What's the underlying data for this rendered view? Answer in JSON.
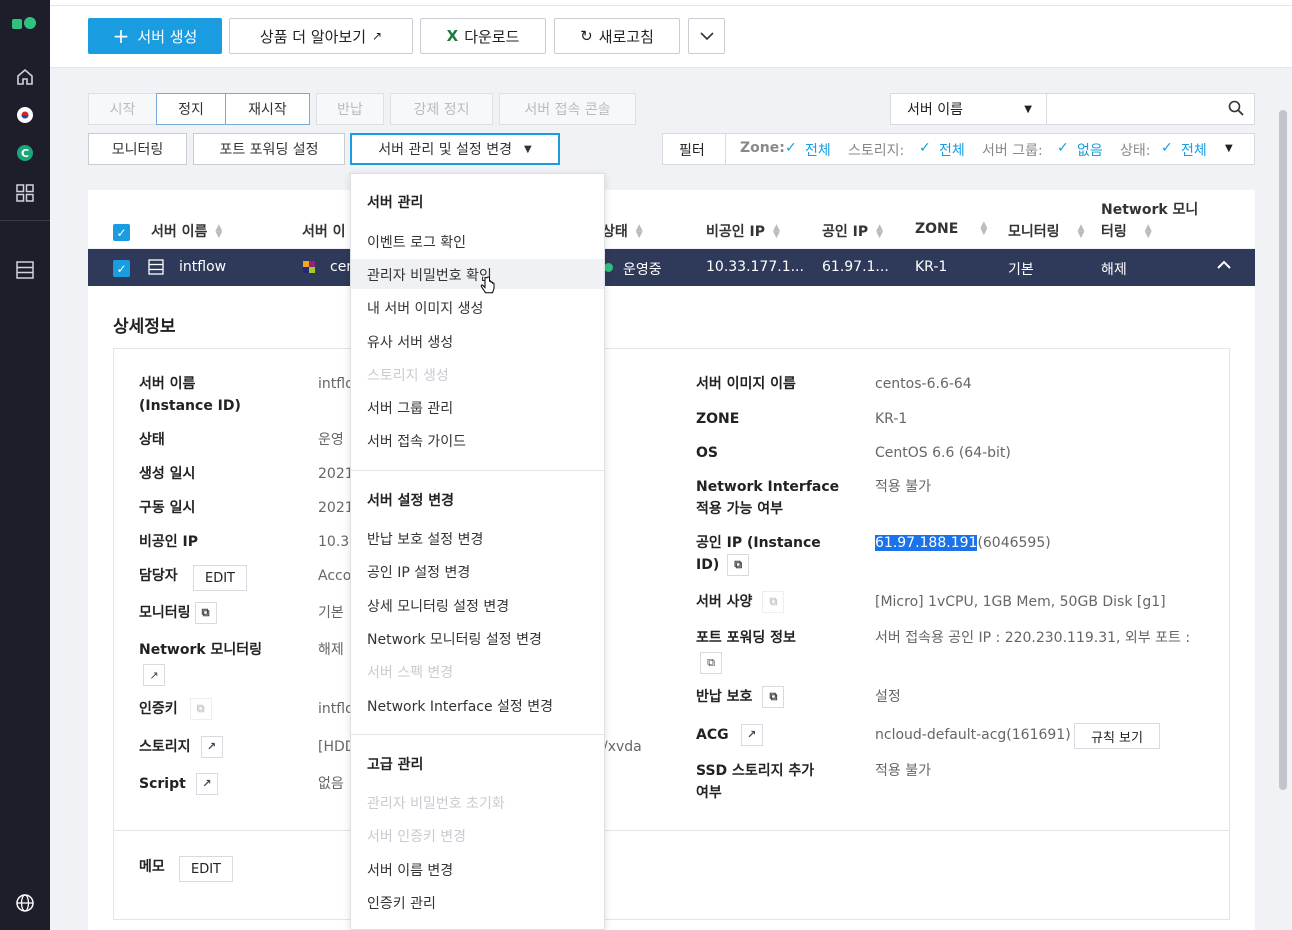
{
  "toolbar": {
    "create_server": "서버 생성",
    "learn_more": "상품 더 알아보기",
    "download": "다운로드",
    "refresh": "새로고침"
  },
  "actions": {
    "start": "시작",
    "stop": "정지",
    "restart": "재시작",
    "return": "반납",
    "force_stop": "강제 정지",
    "console": "서버 접속 콘솔",
    "monitoring": "모니터링",
    "port_forwarding": "포트 포워딩 설정",
    "server_manage": "서버 관리 및 설정 변경"
  },
  "search": {
    "select_value": "서버 이름",
    "placeholder": ""
  },
  "filter": {
    "label": "필터",
    "zone_label": "Zone:",
    "zone_value": "전체",
    "storage_label": "스토리지:",
    "storage_value": "전체",
    "group_label": "서버 그룹:",
    "group_value": "없음",
    "status_label": "상태:",
    "status_value": "전체"
  },
  "table": {
    "headers": {
      "server_name": "서버 이름",
      "server_image": "서버 이",
      "status": "상태",
      "private_ip": "비공인 IP",
      "public_ip": "공인 IP",
      "zone": "ZONE",
      "monitoring": "모니터링",
      "network_monitoring_1": "Network 모니",
      "network_monitoring_2": "터링"
    },
    "row": {
      "server_name": "intflow",
      "server_image": "cen",
      "status": "운영중",
      "private_ip": "10.33.177.1...",
      "public_ip": "61.97.1...",
      "zone": "KR-1",
      "monitoring": "기본",
      "network_monitoring": "해제"
    }
  },
  "detail": {
    "title": "상세정보",
    "left": {
      "server_name_label": "서버 이름",
      "instance_id_label": "(Instance ID)",
      "server_name_value": "intflo",
      "status_label": "상태",
      "status_value": "운영",
      "created_label": "생성 일시",
      "created_value": "2021",
      "started_label": "구동 일시",
      "started_value": "2021",
      "private_ip_label": "비공인 IP",
      "private_ip_value": "10.33",
      "owner_label": "담당자",
      "owner_edit": "EDIT",
      "owner_value": "Acco",
      "monitoring_label": "모니터링",
      "monitoring_value": "기본",
      "net_monitoring_label": "Network 모니터링",
      "net_monitoring_value": "해제",
      "auth_key_label": "인증키",
      "auth_key_value": "intflo",
      "storage_label": "스토리지",
      "storage_value": "[HDD",
      "storage_value_tail": "/xvda",
      "script_label": "Script",
      "script_value": "없음",
      "memo_label": "메모",
      "memo_edit": "EDIT"
    },
    "right": {
      "image_name_label": "서버 이미지 이름",
      "image_name_value": "centos-6.6-64",
      "zone_label": "ZONE",
      "zone_value": "KR-1",
      "os_label": "OS",
      "os_value": "CentOS 6.6 (64-bit)",
      "ni_label_1": "Network Interface",
      "ni_label_2": "적용 가능 여부",
      "ni_value": "적용 불가",
      "public_ip_label_1": "공인 IP (Instance",
      "public_ip_label_2": "ID)",
      "public_ip_value": "61.97.188.191",
      "public_ip_id": "(6046595)",
      "spec_label": "서버 사양",
      "spec_value": "[Micro] 1vCPU, 1GB Mem, 50GB Disk [g1]",
      "port_label": "포트 포워딩 정보",
      "port_value": "서버 접속용 공인 IP : 220.230.119.31, 외부 포트 :",
      "return_protect_label": "반납 보호",
      "return_protect_value": "설정",
      "acg_label": "ACG",
      "acg_value": "ncloud-default-acg(161691)",
      "acg_rules": "규칙 보기",
      "ssd_label_1": "SSD 스토리지 추가",
      "ssd_label_2": "여부",
      "ssd_value": "적용 불가"
    }
  },
  "dropdown": {
    "section1": "서버 관리",
    "items1": [
      "이벤트 로그 확인",
      "관리자 비밀번호 확인",
      "내 서버 이미지 생성",
      "유사 서버 생성",
      "스토리지 생성",
      "서버 그룹 관리",
      "서버 접속 가이드"
    ],
    "section2": "서버 설정 변경",
    "items2": [
      "반납 보호 설정 변경",
      "공인 IP 설정 변경",
      "상세 모니터링 설정 변경",
      "Network 모니터링 설정 변경",
      "서버 스펙 변경",
      "Network Interface 설정 변경"
    ],
    "section3": "고급 관리",
    "items3": [
      "관리자 비밀번호 초기화",
      "서버 인증키 변경",
      "서버 이름 변경",
      "인증키 관리"
    ]
  },
  "colors": {
    "primary": "#1a9ce0",
    "sidebar": "#1e1e2a",
    "selected_row": "#2f3959",
    "running": "#2ec27e"
  }
}
